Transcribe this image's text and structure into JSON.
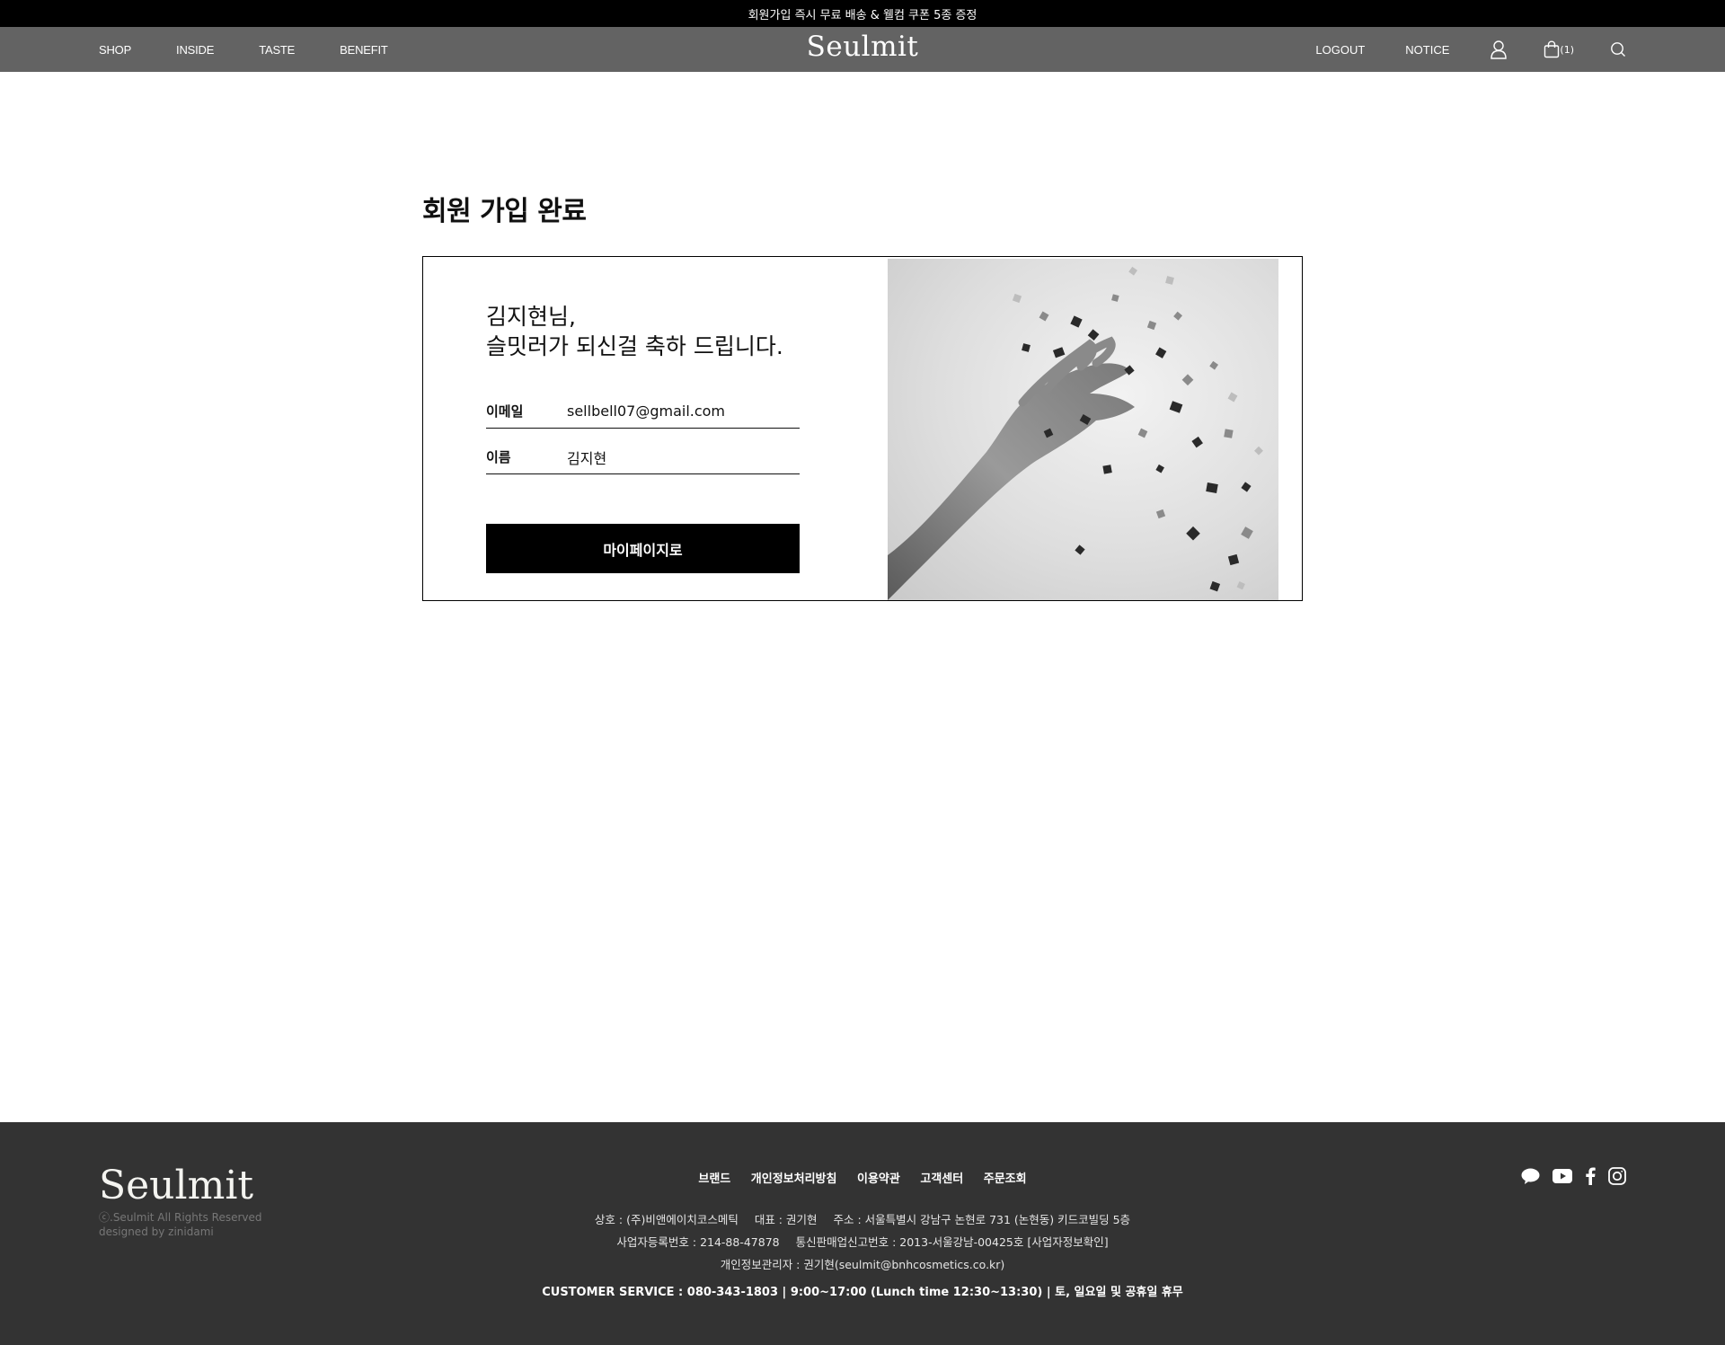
{
  "promo": {
    "text": "회원가입 즉시 무료 배송 & 웰컴 쿠폰 5종 증정"
  },
  "header": {
    "nav_left": [
      "SHOP",
      "INSIDE",
      "TASTE",
      "BENEFIT"
    ],
    "logo": "Seulmit",
    "logout": "LOGOUT",
    "notice": "NOTICE",
    "cart_count": "(1)"
  },
  "main": {
    "title": "회원 가입 완료",
    "greeting_line1": "김지현님,",
    "greeting_line2": "슬밋러가 되신걸 축하 드립니다.",
    "email_label": "이메일",
    "email_value": "sellbell07@gmail.com",
    "name_label": "이름",
    "name_value": "김지현",
    "mypage_button": "마이페이지로"
  },
  "footer": {
    "logo": "Seulmit",
    "copyright": "ⓒ.Seulmit All Rights Reserved",
    "designed_by": "designed by zinidami",
    "links": [
      "브랜드",
      "개인정보처리방침",
      "이용약관",
      "고객센터",
      "주문조회"
    ],
    "company": "상호 : (주)비앤에이치코스메틱",
    "ceo": "대표 : 권기현",
    "address": "주소 : 서울특별시 강남구 논현로 731 (논현동) 키드코빌딩 5층",
    "biz_no": "사업자등록번호 : 214-88-47878",
    "ecommerce_no": "통신판매업신고번호 : 2013-서울강남-00425호 [사업자정보확인]",
    "privacy_manager": "개인정보관리자 : 권기현(seulmit@bnhcosmetics.co.kr)",
    "customer_service": "CUSTOMER SERVICE : 080-343-1803 | 9:00~17:00 (Lunch time 12:30~13:30) | 토, 일요일 및 공휴일 휴무"
  },
  "colors": {
    "header_bg": "#636363",
    "promo_bg": "#000000",
    "footer_bg": "#333333",
    "button_bg": "#000000"
  }
}
